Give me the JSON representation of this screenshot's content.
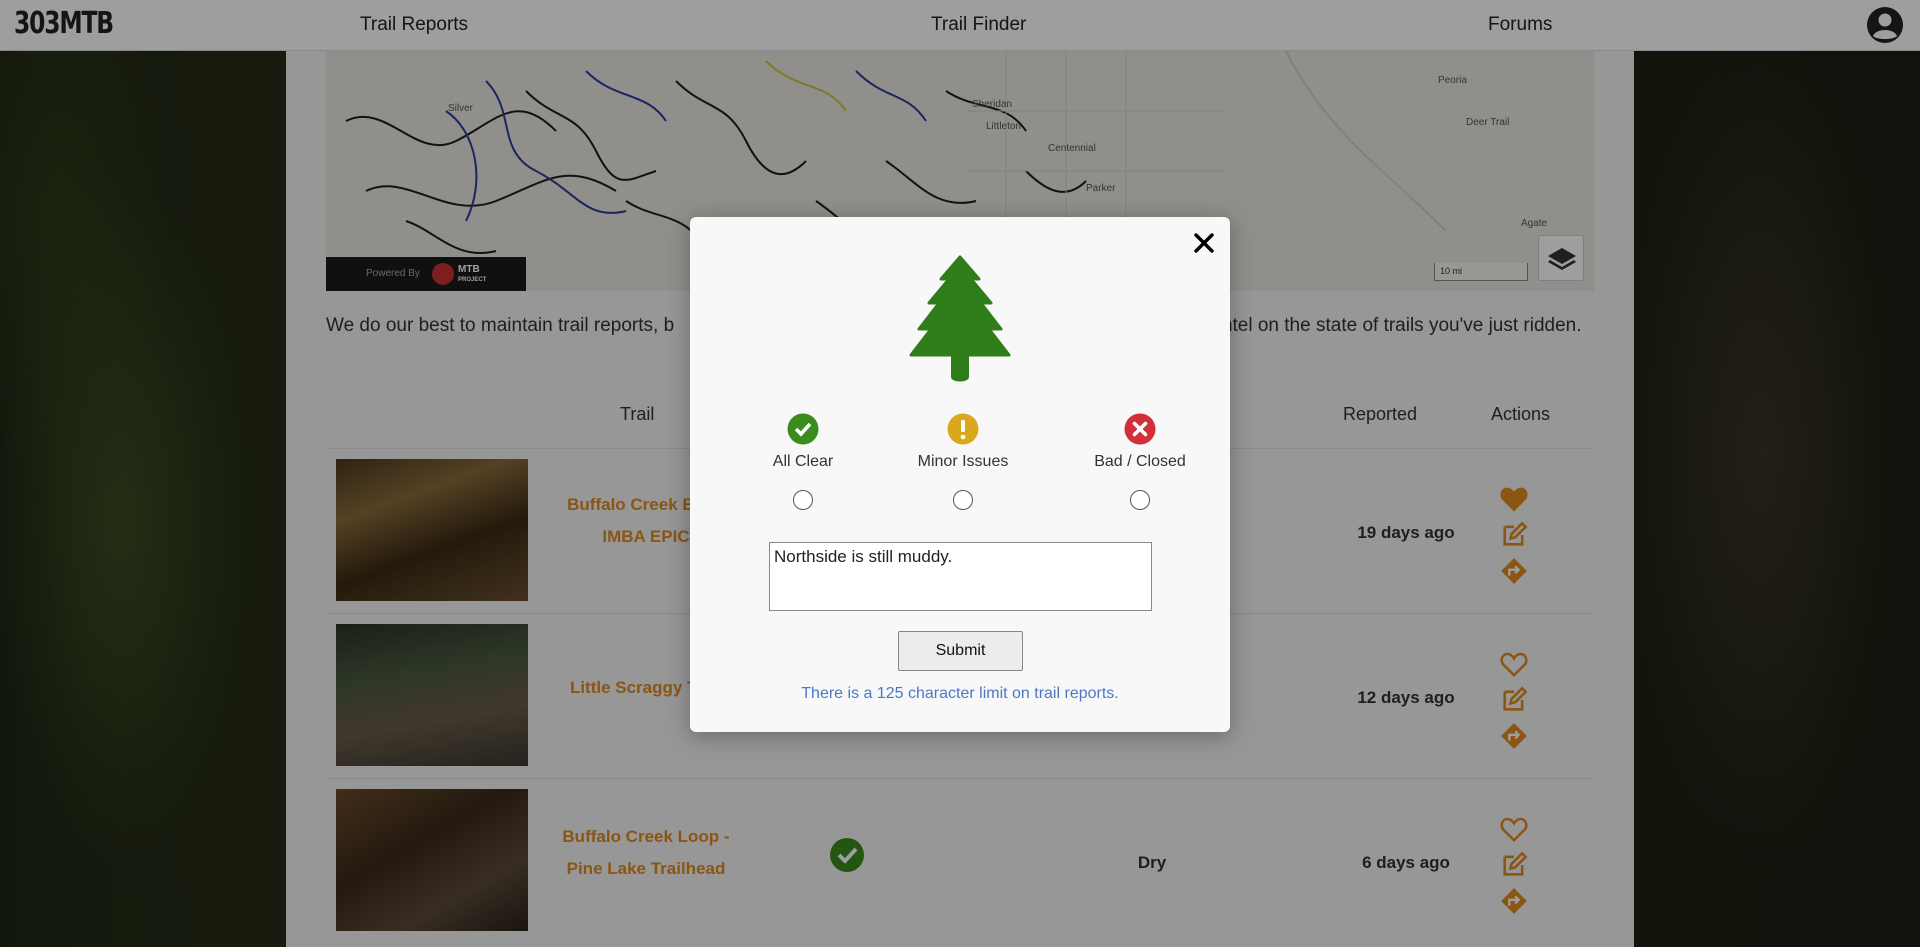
{
  "app": {
    "logo": "303MTB"
  },
  "nav": {
    "items": [
      "Trail Reports",
      "Trail Finder",
      "Forums"
    ]
  },
  "map": {
    "attribution_prefix": "Powered By",
    "attribution_brand": "MTB",
    "attribution_sub": "PROJECT",
    "scale_label": "10 mi",
    "places": [
      "Sheridan",
      "Littleton",
      "Centennial",
      "Parker",
      "Peoria",
      "Deer Trail",
      "Agate",
      "Silver"
    ]
  },
  "intro": {
    "text": "We do our best to maintain trail reports, b",
    "text_after_icon": " your own intel on the state of trails you've just ridden."
  },
  "table": {
    "headers": {
      "trail": "Trail",
      "reported": "Reported",
      "actions": "Actions"
    },
    "rows": [
      {
        "name": "Buffalo Creek Big L\nIMBA EPIC",
        "condition": "",
        "reported": "19 days ago",
        "favorited": true
      },
      {
        "name": "Little Scraggy Trail",
        "condition": "",
        "reported": "12 days ago",
        "favorited": false
      },
      {
        "name": "Buffalo Creek Loop - Pine Lake Trailhead",
        "condition": "Dry",
        "reported": "6 days ago",
        "favorited": false
      }
    ]
  },
  "modal": {
    "options": [
      {
        "label": "All Clear",
        "icon": "check-circle-icon",
        "color": "#3a8c1e"
      },
      {
        "label": "Minor Issues",
        "icon": "exclamation-circle-icon",
        "color": "#d9a81c"
      },
      {
        "label": "Bad / Closed",
        "icon": "x-circle-icon",
        "color": "#d1303a"
      }
    ],
    "report_text": "Northside is still muddy.",
    "submit_label": "Submit",
    "limit_note": "There is a 125 character limit on trail reports."
  },
  "colors": {
    "accent": "#e08a1e",
    "tree": "#2e7d1a",
    "link": "#4a78c8"
  }
}
